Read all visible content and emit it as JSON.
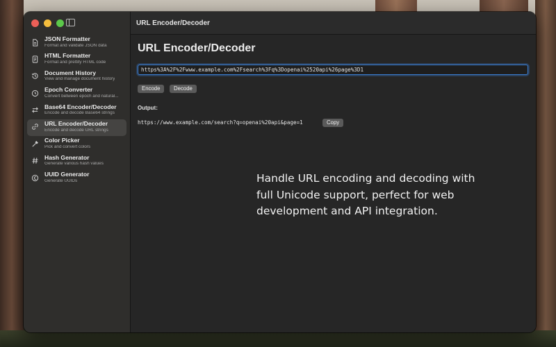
{
  "window": {
    "title": "URL Encoder/Decoder"
  },
  "sidebar": {
    "items": [
      {
        "title": "JSON Formatter",
        "subtitle": "Format and validate JSON data",
        "icon": "document-icon"
      },
      {
        "title": "HTML Formatter",
        "subtitle": "Format and prettify HTML code",
        "icon": "html-doc-icon"
      },
      {
        "title": "Document History",
        "subtitle": "View and manage document history",
        "icon": "clock-history-icon"
      },
      {
        "title": "Epoch Converter",
        "subtitle": "Convert between epoch and natural...",
        "icon": "clock-icon"
      },
      {
        "title": "Base64 Encoder/Decoder",
        "subtitle": "Encode and decode Base64 strings",
        "icon": "arrows-icon"
      },
      {
        "title": "URL Encoder/Decoder",
        "subtitle": "Encode and decode URL strings",
        "icon": "link-icon",
        "active": true
      },
      {
        "title": "Color Picker",
        "subtitle": "Pick and convert colors",
        "icon": "eyedropper-icon"
      },
      {
        "title": "Hash Generator",
        "subtitle": "Generate various hash values",
        "icon": "hash-icon"
      },
      {
        "title": "UUID Generator",
        "subtitle": "Generate UUIDs",
        "icon": "uuid-icon"
      }
    ]
  },
  "main": {
    "page_title": "URL Encoder/Decoder",
    "input_value": "https%3A%2F%2Fwww.example.com%2Fsearch%3Fq%3Dopenai%2520api%26page%3D1",
    "encode_label": "Encode",
    "decode_label": "Decode",
    "output_label": "Output:",
    "output_value": "https://www.example.com/search?q=openai%20api&page=1",
    "copy_label": "Copy"
  },
  "promo": {
    "text": "Handle URL encoding and decoding with full Unicode support, perfect for web development and API integration."
  },
  "colors": {
    "accent": "#3b7fd4",
    "close": "#ec5f57",
    "minimize": "#f4bd3d",
    "zoom": "#5cc84a"
  }
}
